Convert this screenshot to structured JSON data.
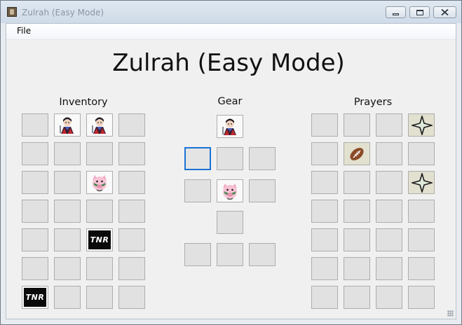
{
  "window": {
    "title": "Zulrah (Easy Mode)",
    "controls": [
      "minimize",
      "maximize",
      "close"
    ]
  },
  "menu": {
    "file": "File"
  },
  "main": {
    "title": "Zulrah (Easy Mode)"
  },
  "inventory": {
    "title": "Inventory",
    "rows": [
      [
        "",
        "mage-warrior-icon",
        "mage-warrior-icon",
        ""
      ],
      [
        "",
        "",
        "",
        ""
      ],
      [
        "",
        "",
        "pig-jester-icon",
        ""
      ],
      [
        "",
        "",
        "",
        ""
      ],
      [
        "",
        "",
        "tnr-logo-icon",
        ""
      ],
      [
        "",
        "",
        "",
        ""
      ],
      [
        "tnr-logo-icon",
        "",
        "",
        ""
      ]
    ],
    "tnr_text": "TNR"
  },
  "gear": {
    "title": "Gear",
    "slots": {
      "head": "mage-warrior-icon",
      "cape": "",
      "neck": "",
      "ammo": "",
      "weapon": "",
      "body": "pig-jester-icon",
      "shield": "",
      "legs": "",
      "gloves": "",
      "boots": "",
      "ring": ""
    },
    "selected_slot": "cape"
  },
  "prayers": {
    "title": "Prayers",
    "rows": [
      [
        "",
        "",
        "",
        "star-icon"
      ],
      [
        "",
        "football-icon",
        "",
        ""
      ],
      [
        "",
        "",
        "",
        "star-icon"
      ],
      [
        "",
        "",
        "",
        ""
      ],
      [
        "",
        "",
        "",
        ""
      ],
      [
        "",
        "",
        "",
        ""
      ],
      [
        "",
        "",
        "",
        ""
      ]
    ]
  },
  "colors": {
    "selection": "#1a73d4",
    "slot_bg": "#e1e1e1",
    "slot_border": "#adadad",
    "prayer_active_bg": "#e2e0cf"
  }
}
